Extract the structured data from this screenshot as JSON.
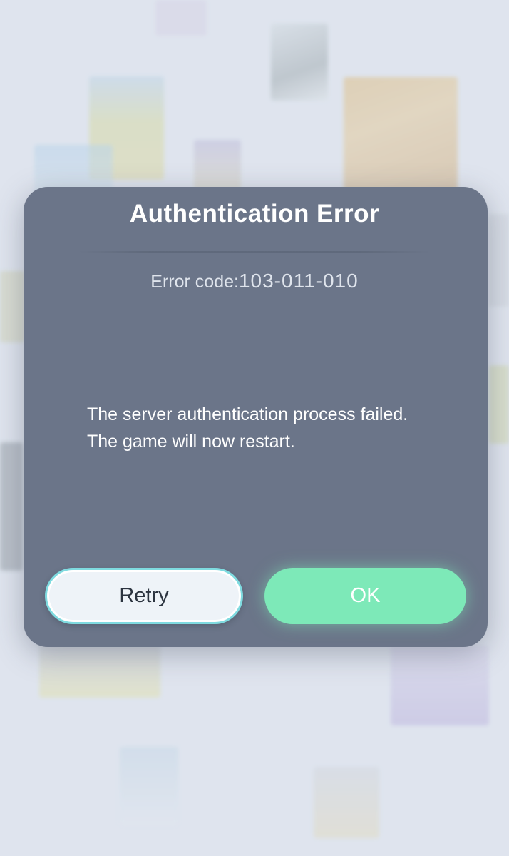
{
  "dialog": {
    "title": "Authentication Error",
    "error_code_label": "Error code:",
    "error_code_value": "103-011-010",
    "message_line1": "The server authentication process failed.",
    "message_line2": "The game will now restart."
  },
  "buttons": {
    "retry_label": "Retry",
    "ok_label": "OK"
  },
  "colors": {
    "dialog_bg": "#6b7589",
    "ok_button": "#7de9b8",
    "retry_border": "#7fdbe0",
    "screen_bg": "#dde3ee"
  }
}
